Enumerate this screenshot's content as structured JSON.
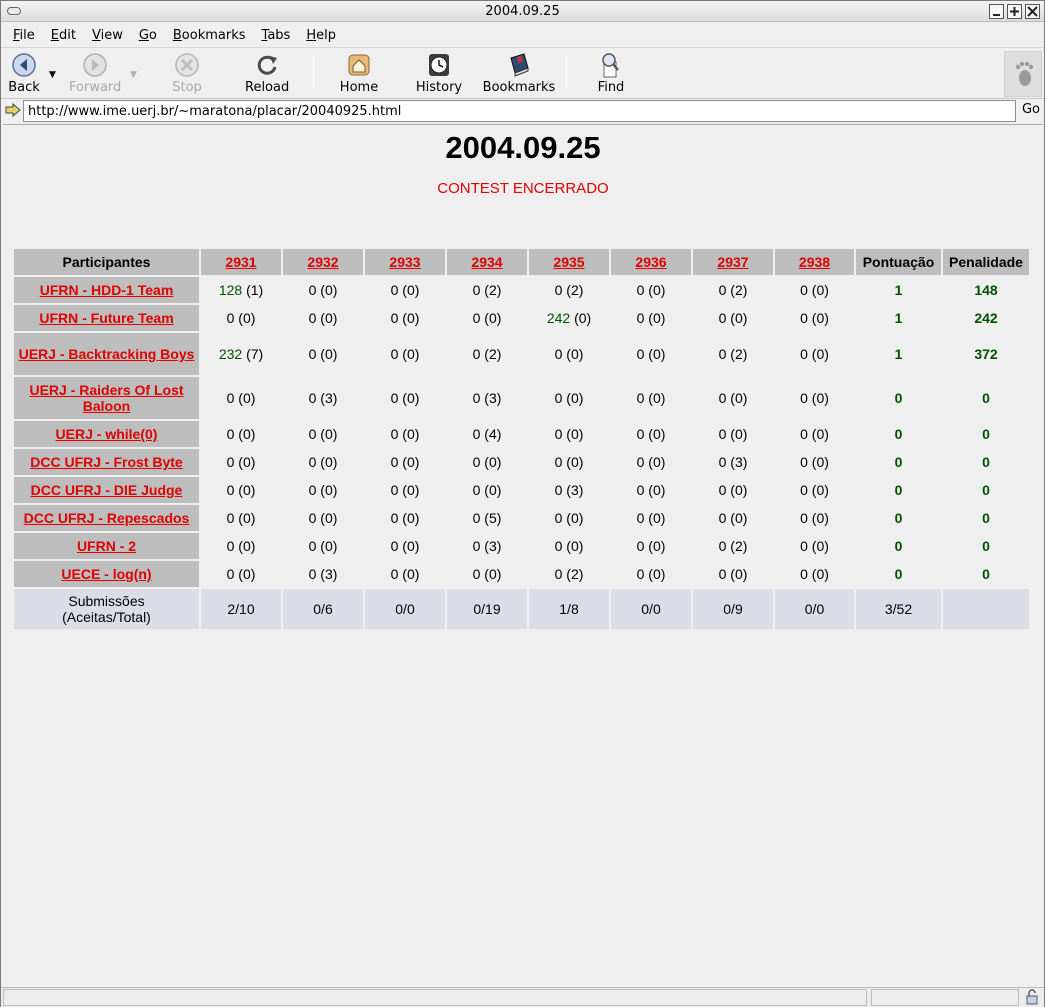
{
  "window": {
    "title": "2004.09.25"
  },
  "menu": [
    {
      "pre": "",
      "u": "F",
      "post": "ile"
    },
    {
      "pre": "",
      "u": "E",
      "post": "dit"
    },
    {
      "pre": "",
      "u": "V",
      "post": "iew"
    },
    {
      "pre": "",
      "u": "G",
      "post": "o"
    },
    {
      "pre": "",
      "u": "B",
      "post": "ookmarks"
    },
    {
      "pre": "",
      "u": "T",
      "post": "abs"
    },
    {
      "pre": "",
      "u": "H",
      "post": "elp"
    }
  ],
  "toolbar": {
    "back": "Back",
    "forward": "Forward",
    "stop": "Stop",
    "reload": "Reload",
    "home": "Home",
    "history": "History",
    "bookmarks": "Bookmarks",
    "find": "Find"
  },
  "urlbar": {
    "url": "http://www.ime.uerj.br/~maratona/placar/20040925.html",
    "go": "Go"
  },
  "page": {
    "title": "2004.09.25",
    "status": "CONTEST ENCERRADO",
    "colors": {
      "link": "#e00000",
      "accepted": "#005000",
      "header_bg": "#bdbdbd",
      "footer_bg": "#dcdce6"
    },
    "headers": {
      "participants": "Participantes",
      "problems": [
        "2931",
        "2932",
        "2933",
        "2934",
        "2935",
        "2936",
        "2937",
        "2938"
      ],
      "score": "Pontuação",
      "penalty": "Penalidade"
    },
    "rows": [
      {
        "team": "UFRN - HDD-1 Team",
        "cells": [
          {
            "a": "128",
            "t": "(1)"
          },
          {
            "a": "0",
            "t": "(0)"
          },
          {
            "a": "0",
            "t": "(0)"
          },
          {
            "a": "0",
            "t": "(2)"
          },
          {
            "a": "0",
            "t": "(2)"
          },
          {
            "a": "0",
            "t": "(0)"
          },
          {
            "a": "0",
            "t": "(2)"
          },
          {
            "a": "0",
            "t": "(0)"
          }
        ],
        "score": "1",
        "penalty": "148"
      },
      {
        "team": "UFRN - Future Team",
        "cells": [
          {
            "a": "0",
            "t": "(0)"
          },
          {
            "a": "0",
            "t": "(0)"
          },
          {
            "a": "0",
            "t": "(0)"
          },
          {
            "a": "0",
            "t": "(0)"
          },
          {
            "a": "242",
            "t": "(0)"
          },
          {
            "a": "0",
            "t": "(0)"
          },
          {
            "a": "0",
            "t": "(0)"
          },
          {
            "a": "0",
            "t": "(0)"
          }
        ],
        "score": "1",
        "penalty": "242"
      },
      {
        "team": "UERJ - Backtracking Boys",
        "cells": [
          {
            "a": "232",
            "t": "(7)"
          },
          {
            "a": "0",
            "t": "(0)"
          },
          {
            "a": "0",
            "t": "(0)"
          },
          {
            "a": "0",
            "t": "(2)"
          },
          {
            "a": "0",
            "t": "(0)"
          },
          {
            "a": "0",
            "t": "(0)"
          },
          {
            "a": "0",
            "t": "(2)"
          },
          {
            "a": "0",
            "t": "(0)"
          }
        ],
        "score": "1",
        "penalty": "372"
      },
      {
        "team": "UERJ - Raiders Of Lost Baloon",
        "cells": [
          {
            "a": "0",
            "t": "(0)"
          },
          {
            "a": "0",
            "t": "(3)"
          },
          {
            "a": "0",
            "t": "(0)"
          },
          {
            "a": "0",
            "t": "(3)"
          },
          {
            "a": "0",
            "t": "(0)"
          },
          {
            "a": "0",
            "t": "(0)"
          },
          {
            "a": "0",
            "t": "(0)"
          },
          {
            "a": "0",
            "t": "(0)"
          }
        ],
        "score": "0",
        "penalty": "0"
      },
      {
        "team": "UERJ - while(0)",
        "cells": [
          {
            "a": "0",
            "t": "(0)"
          },
          {
            "a": "0",
            "t": "(0)"
          },
          {
            "a": "0",
            "t": "(0)"
          },
          {
            "a": "0",
            "t": "(4)"
          },
          {
            "a": "0",
            "t": "(0)"
          },
          {
            "a": "0",
            "t": "(0)"
          },
          {
            "a": "0",
            "t": "(0)"
          },
          {
            "a": "0",
            "t": "(0)"
          }
        ],
        "score": "0",
        "penalty": "0"
      },
      {
        "team": "DCC UFRJ - Frost Byte",
        "cells": [
          {
            "a": "0",
            "t": "(0)"
          },
          {
            "a": "0",
            "t": "(0)"
          },
          {
            "a": "0",
            "t": "(0)"
          },
          {
            "a": "0",
            "t": "(0)"
          },
          {
            "a": "0",
            "t": "(0)"
          },
          {
            "a": "0",
            "t": "(0)"
          },
          {
            "a": "0",
            "t": "(3)"
          },
          {
            "a": "0",
            "t": "(0)"
          }
        ],
        "score": "0",
        "penalty": "0"
      },
      {
        "team": "DCC UFRJ - DIE Judge",
        "cells": [
          {
            "a": "0",
            "t": "(0)"
          },
          {
            "a": "0",
            "t": "(0)"
          },
          {
            "a": "0",
            "t": "(0)"
          },
          {
            "a": "0",
            "t": "(0)"
          },
          {
            "a": "0",
            "t": "(3)"
          },
          {
            "a": "0",
            "t": "(0)"
          },
          {
            "a": "0",
            "t": "(0)"
          },
          {
            "a": "0",
            "t": "(0)"
          }
        ],
        "score": "0",
        "penalty": "0"
      },
      {
        "team": "DCC UFRJ - Repescados",
        "cells": [
          {
            "a": "0",
            "t": "(0)"
          },
          {
            "a": "0",
            "t": "(0)"
          },
          {
            "a": "0",
            "t": "(0)"
          },
          {
            "a": "0",
            "t": "(5)"
          },
          {
            "a": "0",
            "t": "(0)"
          },
          {
            "a": "0",
            "t": "(0)"
          },
          {
            "a": "0",
            "t": "(0)"
          },
          {
            "a": "0",
            "t": "(0)"
          }
        ],
        "score": "0",
        "penalty": "0"
      },
      {
        "team": "UFRN - 2",
        "cells": [
          {
            "a": "0",
            "t": "(0)"
          },
          {
            "a": "0",
            "t": "(0)"
          },
          {
            "a": "0",
            "t": "(0)"
          },
          {
            "a": "0",
            "t": "(3)"
          },
          {
            "a": "0",
            "t": "(0)"
          },
          {
            "a": "0",
            "t": "(0)"
          },
          {
            "a": "0",
            "t": "(2)"
          },
          {
            "a": "0",
            "t": "(0)"
          }
        ],
        "score": "0",
        "penalty": "0"
      },
      {
        "team": "UECE - log(n)",
        "cells": [
          {
            "a": "0",
            "t": "(0)"
          },
          {
            "a": "0",
            "t": "(3)"
          },
          {
            "a": "0",
            "t": "(0)"
          },
          {
            "a": "0",
            "t": "(0)"
          },
          {
            "a": "0",
            "t": "(2)"
          },
          {
            "a": "0",
            "t": "(0)"
          },
          {
            "a": "0",
            "t": "(0)"
          },
          {
            "a": "0",
            "t": "(0)"
          }
        ],
        "score": "0",
        "penalty": "0"
      }
    ],
    "footer": {
      "label_line1": "Submissões",
      "label_line2": "(Aceitas/Total)",
      "values": [
        "2/10",
        "0/6",
        "0/0",
        "0/19",
        "1/8",
        "0/0",
        "0/9",
        "0/0"
      ],
      "total": "3/52",
      "penalty": ""
    }
  }
}
